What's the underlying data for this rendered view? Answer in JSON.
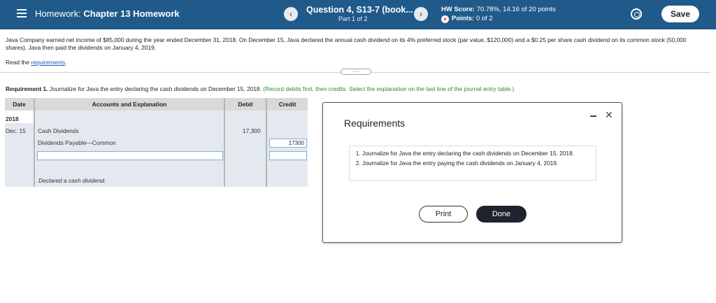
{
  "header": {
    "hw_prefix": "Homework:",
    "hw_name": "Chapter 13 Homework",
    "prev_arrow": "‹",
    "next_arrow": "›",
    "question_title": "Question 4, S13-7 (book...",
    "part": "Part 1 of 2",
    "hw_score_label": "HW Score:",
    "hw_score_value": "70.78%, 14.16 of 20 points",
    "points_label": "Points:",
    "points_value": "0 of 2",
    "save_label": "Save"
  },
  "problem": {
    "text": "Java Company earned net income of $85,000 during the year ended December 31, 2018. On December 15, Java declared the annual cash dividend on its 4% preferred stock (par value, $120,000) and a $0.25 per share cash dividend on its common stock (50,000 shares). Java then paid the dividends on January 4, 2019.",
    "read_prefix": "Read the",
    "read_link": "requirements",
    "read_suffix": ".",
    "expander": "....."
  },
  "requirement1": {
    "label": "Requirement 1.",
    "text": "Journalize for Java the entry declaring the cash dividends on December 15, 2018.",
    "hint": "(Record debits first, then credits. Select the explanation on the last line of the journal entry table.)"
  },
  "journal": {
    "headers": {
      "date": "Date",
      "accounts": "Accounts and Explanation",
      "debit": "Debit",
      "credit": "Credit"
    },
    "year": "2018",
    "date": "Dec. 15",
    "row1_account": "Cash Dividends",
    "row1_debit": "17,300",
    "row2_account": "Dividends Payable—Common",
    "row2_credit": "17300",
    "row3_account": "",
    "row3_credit": "",
    "explanation": "Declared a cash dividend."
  },
  "modal": {
    "title": "Requirements",
    "items": [
      "Journalize for Java the entry declaring the cash dividends on December 15, 2018.",
      "Journalize for Java the entry paying the cash dividends on January 4, 2019."
    ],
    "print_label": "Print",
    "done_label": "Done",
    "minimize": "–",
    "close": "✕"
  }
}
